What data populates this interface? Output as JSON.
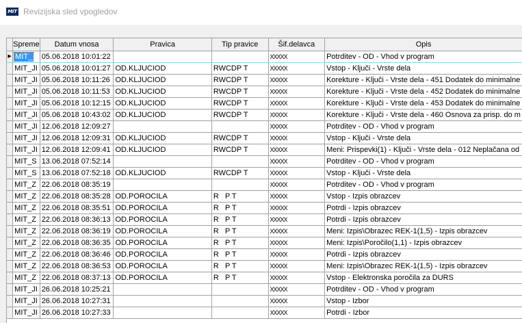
{
  "window": {
    "title": "Revizijska sled vpogledov",
    "logo_text": "MIT"
  },
  "table": {
    "columns": [
      "Spreme",
      "Datum vnosa",
      "Pravica",
      "Tip pravice",
      "Šif.delavca",
      "Opis"
    ],
    "selected_row": 0,
    "row_indicator": "▶",
    "rows": [
      [
        "MIT_",
        "05.06.2018 10:01:22",
        "",
        "",
        "XXXXX",
        "Potrditev - OD - Vhod v program"
      ],
      [
        "MIT_JI",
        "05.06.2018 10:01:27",
        "OD.KLJUCIOD",
        "RWCDP T",
        "XXXXX",
        "Vstop - Ključi - Vrste dela"
      ],
      [
        "MIT_JI",
        "05.06.2018 10:11:26",
        "OD.KLJUCIOD",
        "RWCDP T",
        "XXXXX",
        "Korekture - Ključi - Vrste dela - 451 Dodatek do minimalne"
      ],
      [
        "MIT_JI",
        "05.06.2018 10:11:53",
        "OD.KLJUCIOD",
        "RWCDP T",
        "XXXXX",
        "Korekture - Ključi - Vrste dela - 452 Dodatek do minimalne"
      ],
      [
        "MIT_JI",
        "05.06.2018 10:12:15",
        "OD.KLJUCIOD",
        "RWCDP T",
        "XXXXX",
        "Korekture - Ključi - Vrste dela - 453 Dodatek do minimalne"
      ],
      [
        "MIT_JI",
        "05.06.2018 10:43:02",
        "OD.KLJUCIOD",
        "RWCDP T",
        "XXXXX",
        "Korekture - Ključi - Vrste dela - 460 Osnova za prisp. do m"
      ],
      [
        "MIT_JI",
        "12.06.2018 12:09:27",
        "",
        "",
        "XXXXX",
        "Potrditev - OD - Vhod v program"
      ],
      [
        "MIT_JI",
        "12.06.2018 12:09:31",
        "OD.KLJUCIOD",
        "RWCDP T",
        "XXXXX",
        "Vstop - Ključi - Vrste dela"
      ],
      [
        "MIT_JI",
        "12.06.2018 12:09:41",
        "OD.KLJUCIOD",
        "RWCDP T",
        "XXXXX",
        "Meni: Prispevki(1) - Ključi - Vrste dela - 012 Neplačana od"
      ],
      [
        "MIT_S",
        "13.06.2018 07:52:14",
        "",
        "",
        "XXXXX",
        "Potrditev - OD - Vhod v program"
      ],
      [
        "MIT_S",
        "13.06.2018 07:52:18",
        "OD.KLJUCIOD",
        "RWCDP T",
        "XXXXX",
        "Vstop - Ključi - Vrste dela"
      ],
      [
        "MIT_Z",
        "22.06.2018 08:35:19",
        "",
        "",
        "XXXXX",
        "Potrditev - OD - Vhod v program"
      ],
      [
        "MIT_Z",
        "22.06.2018 08:35:28",
        "OD.POROCILA",
        "R   P T",
        "XXXXX",
        "Vstop - Izpis obrazcev"
      ],
      [
        "MIT_Z",
        "22.06.2018 08:35:51",
        "OD.POROCILA",
        "R   P T",
        "XXXXX",
        "Potrdi - Izpis obrazcev"
      ],
      [
        "MIT_Z",
        "22.06.2018 08:36:13",
        "OD.POROCILA",
        "R   P T",
        "XXXXX",
        "Potrdi - Izpis obrazcev"
      ],
      [
        "MIT_Z",
        "22.06.2018 08:36:19",
        "OD.POROCILA",
        "R   P T",
        "XXXXX",
        "Meni: Izpis\\Obrazec REK-1(1,5) - Izpis obrazcev"
      ],
      [
        "MIT_Z",
        "22.06.2018 08:36:35",
        "OD.POROCILA",
        "R   P T",
        "XXXXX",
        "Meni: Izpis\\Poročilo(1,1) - Izpis obrazcev"
      ],
      [
        "MIT_Z",
        "22.06.2018 08:36:46",
        "OD.POROCILA",
        "R   P T",
        "XXXXX",
        "Potrdi - Izpis obrazcev"
      ],
      [
        "MIT_Z",
        "22.06.2018 08:36:53",
        "OD.POROCILA",
        "R   P T",
        "XXXXX",
        "Meni: Izpis\\Obrazec REK-1(1,5) - Izpis obrazcev"
      ],
      [
        "MIT_Z",
        "22.06.2018 08:37:13",
        "OD.POROCILA",
        "R   P T",
        "XXXXX",
        "Vstop - Elektronska poročila za DURS"
      ],
      [
        "MIT_JI",
        "26.06.2018 10:25:21",
        "",
        "",
        "XXXXX",
        "Potrditev - OD - Vhod v program"
      ],
      [
        "MIT_JI",
        "26.06.2018 10:27:31",
        "",
        "",
        "XXXXX",
        "Vstop - Izbor"
      ],
      [
        "MIT_JI",
        "26.06.2018 10:27:33",
        "",
        "",
        "XXXXX",
        "Potrdi - Izbor"
      ]
    ]
  }
}
